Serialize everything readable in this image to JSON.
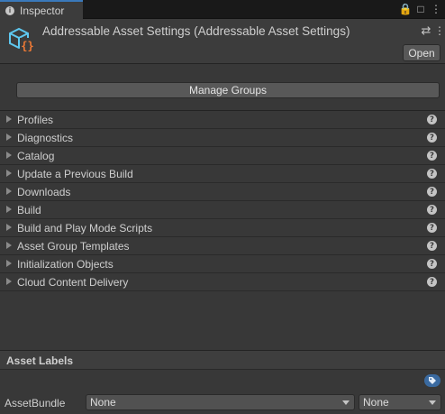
{
  "tab": {
    "label": "Inspector",
    "icon": "info-icon"
  },
  "tab_controls": [
    {
      "name": "lock-icon",
      "glyph": "🔒"
    },
    {
      "name": "maximize-icon",
      "glyph": "□"
    },
    {
      "name": "kebab-menu-icon",
      "glyph": "⋮"
    }
  ],
  "header": {
    "title": "Addressable Asset Settings (Addressable Asset Settings)",
    "settings_glyph": "⇄",
    "menu_glyph": "⋮",
    "open_label": "Open"
  },
  "manage_groups_label": "Manage Groups",
  "sections": [
    {
      "label": "Profiles"
    },
    {
      "label": "Diagnostics"
    },
    {
      "label": "Catalog"
    },
    {
      "label": "Update a Previous Build"
    },
    {
      "label": "Downloads"
    },
    {
      "label": "Build"
    },
    {
      "label": "Build and Play Mode Scripts"
    },
    {
      "label": "Asset Group Templates"
    },
    {
      "label": "Initialization Objects"
    },
    {
      "label": "Cloud Content Delivery"
    }
  ],
  "help_glyph": "?",
  "asset_labels": {
    "title": "Asset Labels",
    "bundle_label": "AssetBundle",
    "bundle_value": "None",
    "variant_value": "None"
  },
  "colors": {
    "tab_accent": "#3a79bb",
    "icon_cyan": "#5ec8f0",
    "icon_orange": "#f07a35",
    "tag_blue": "#3a6aa0"
  }
}
